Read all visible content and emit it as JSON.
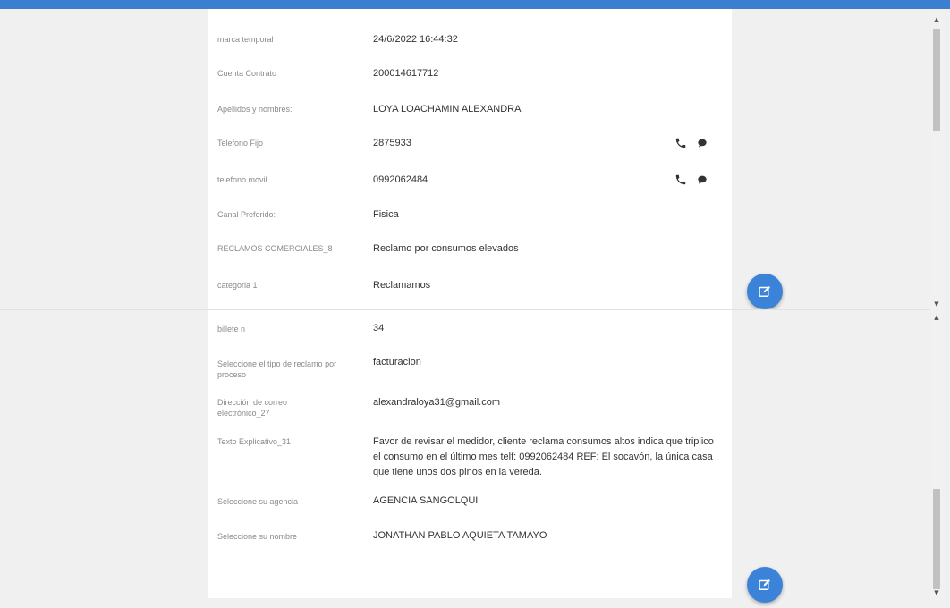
{
  "upper_record": {
    "fields": [
      {
        "label": "marca temporal",
        "value": "24/6/2022 16:44:32"
      },
      {
        "label": "Cuenta Contrato",
        "value": "200014617712"
      },
      {
        "label": "Apellidos y nombres:",
        "value": "LOYA LOACHAMIN ALEXANDRA"
      },
      {
        "label": "Telefono Fijo",
        "value": "2875933"
      },
      {
        "label": "telefono movil",
        "value": "0992062484"
      },
      {
        "label": "Canal Preferido:",
        "value": "Fisica"
      },
      {
        "label": "RECLAMOS COMERCIALES_8",
        "value": "Reclamo por consumos elevados"
      },
      {
        "label": "categoria 1",
        "value": "Reclamamos"
      }
    ]
  },
  "lower_record": {
    "fields": [
      {
        "label": "billete n",
        "value": "34"
      },
      {
        "label": "Seleccione el tipo de reclamo por proceso",
        "value": "facturacion"
      },
      {
        "label": "Dirección de correo electrónico_27",
        "value": "alexandraloya31@gmail.com"
      },
      {
        "label": "Texto Explicativo_31",
        "value": "Favor de revisar el medidor, cliente reclama consumos altos indica que triplico el consumo en el último mes telf: 0992062484 REF: El socavón, la única casa que tiene unos dos pinos en la vereda."
      },
      {
        "label": "Seleccione su agencia",
        "value": "AGENCIA SANGOLQUI"
      },
      {
        "label": "Seleccione su nombre",
        "value": "JONATHAN PABLO AQUIETA TAMAYO"
      }
    ]
  },
  "icons": {
    "phone": "phone-icon",
    "message": "message-icon",
    "edit": "edit-icon"
  },
  "colors": {
    "accent": "#3b82d9",
    "topbar": "#3b7fd0",
    "label": "#8a8a8a",
    "value": "#333333"
  }
}
